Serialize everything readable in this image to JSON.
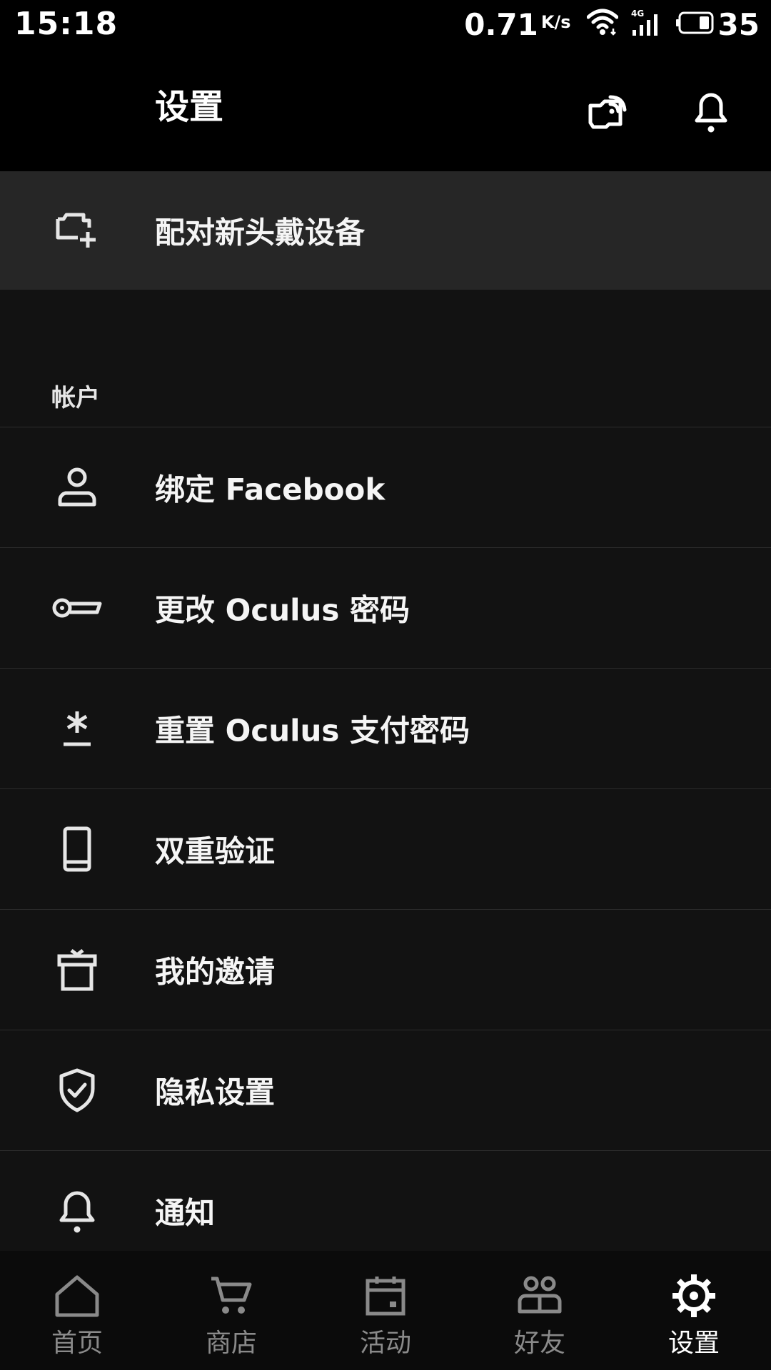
{
  "status_bar": {
    "time": "15:18",
    "net_speed": "0.71",
    "net_unit": "K/s",
    "network_type": "4G",
    "battery": "35"
  },
  "app_bar": {
    "title": "设置",
    "icons": [
      "cast-icon",
      "bell-icon"
    ]
  },
  "pair_device": {
    "label": "配对新头戴设备",
    "icon": "headset-add-icon"
  },
  "account_section": {
    "header": "帐户",
    "items": [
      {
        "label": "绑定 Facebook",
        "icon": "person-icon"
      },
      {
        "label": "更改 Oculus 密码",
        "icon": "key-icon"
      },
      {
        "label": "重置 Oculus 支付密码",
        "icon": "asterisk-icon"
      },
      {
        "label": "双重验证",
        "icon": "phone-icon"
      },
      {
        "label": "我的邀请",
        "icon": "gift-icon"
      },
      {
        "label": "隐私设置",
        "icon": "shield-check-icon"
      },
      {
        "label": "通知",
        "icon": "bell-icon"
      }
    ]
  },
  "bottom_nav": {
    "active": "设置",
    "items": [
      {
        "label": "首页",
        "icon": "home-icon"
      },
      {
        "label": "商店",
        "icon": "cart-icon"
      },
      {
        "label": "活动",
        "icon": "calendar-icon"
      },
      {
        "label": "好友",
        "icon": "friends-icon"
      },
      {
        "label": "设置",
        "icon": "gear-icon"
      }
    ]
  },
  "colors": {
    "background": "#000000",
    "list_background": "#121212",
    "highlight_row": "#262626",
    "divider": "#2c2c2c",
    "text": "#ffffff",
    "nav_inactive": "#8a8a8a"
  }
}
